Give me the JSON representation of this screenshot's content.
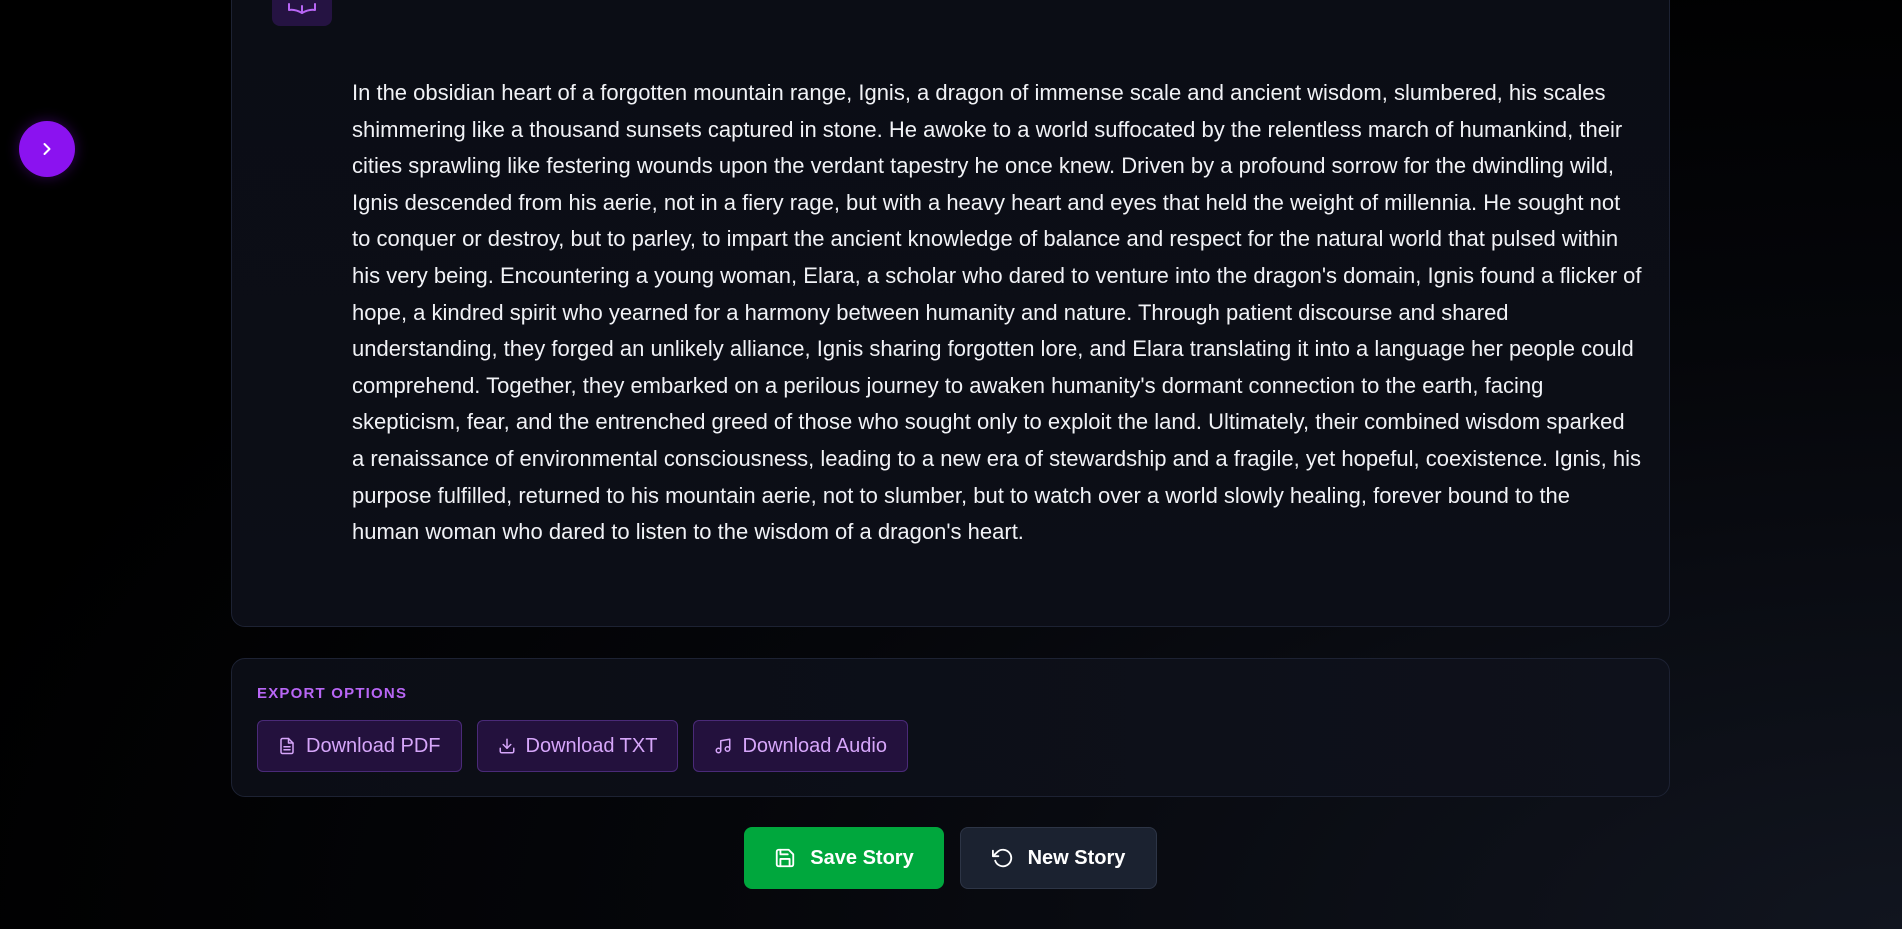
{
  "sidebar": {
    "toggle_icon": "chevron-right-icon",
    "toggle_color": "#8b12f0"
  },
  "story": {
    "icon": "book-open-icon",
    "text": "In the obsidian heart of a forgotten mountain range, Ignis, a dragon of immense scale and ancient wisdom, slumbered, his scales shimmering like a thousand sunsets captured in stone. He awoke to a world suffocated by the relentless march of humankind, their cities sprawling like festering wounds upon the verdant tapestry he once knew. Driven by a profound sorrow for the dwindling wild, Ignis descended from his aerie, not in a fiery rage, but with a heavy heart and eyes that held the weight of millennia. He sought not to conquer or destroy, but to parley, to impart the ancient knowledge of balance and respect for the natural world that pulsed within his very being. Encountering a young woman, Elara, a scholar who dared to venture into the dragon's domain, Ignis found a flicker of hope, a kindred spirit who yearned for a harmony between humanity and nature. Through patient discourse and shared understanding, they forged an unlikely alliance, Ignis sharing forgotten lore, and Elara translating it into a language her people could comprehend. Together, they embarked on a perilous journey to awaken humanity's dormant connection to the earth, facing skepticism, fear, and the entrenched greed of those who sought only to exploit the land. Ultimately, their combined wisdom sparked a renaissance of environmental consciousness, leading to a new era of stewardship and a fragile, yet hopeful, coexistence. Ignis, his purpose fulfilled, returned to his mountain aerie, not to slumber, but to watch over a world slowly healing, forever bound to the human woman who dared to listen to the wisdom of a dragon's heart."
  },
  "export": {
    "label": "EXPORT OPTIONS",
    "buttons": [
      {
        "label": "Download PDF",
        "icon": "file-text-icon"
      },
      {
        "label": "Download TXT",
        "icon": "download-icon"
      },
      {
        "label": "Download Audio",
        "icon": "music-icon"
      }
    ]
  },
  "actions": {
    "save": {
      "label": "Save Story",
      "icon": "save-icon",
      "color": "#00a73d"
    },
    "new": {
      "label": "New Story",
      "icon": "rotate-ccw-icon",
      "color": "#1b2230"
    }
  },
  "colors": {
    "accent": "#8b12f0",
    "export_label": "#b866f5",
    "export_button_text": "#d6a6fa"
  }
}
